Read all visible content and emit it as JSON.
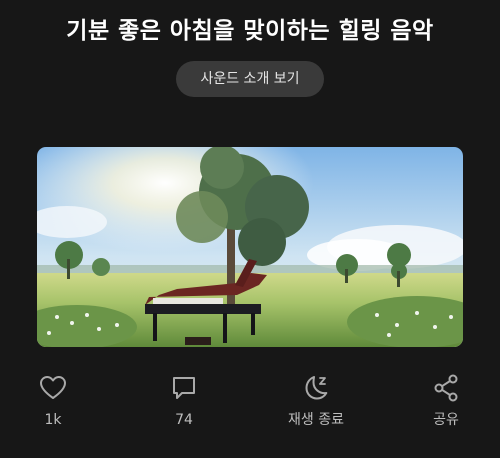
{
  "header": {
    "title": "기분 좋은 아침을 맞이하는 힐링 음악"
  },
  "intro_button": {
    "label": "사운드 소개 보기"
  },
  "hero_image": {
    "icon": "piano-meadow-illustration"
  },
  "actions": {
    "like": {
      "icon": "heart-icon",
      "label": "1k"
    },
    "comment": {
      "icon": "comment-icon",
      "label": "74"
    },
    "sleep_timer": {
      "icon": "moon-zzz-icon",
      "label": "재생 종료"
    },
    "share": {
      "icon": "share-icon",
      "label": "공유"
    }
  },
  "colors": {
    "background": "#171717",
    "button_bg": "#3a3a3a",
    "icon_color": "#a9a9a9",
    "label_color": "#bdbdbd"
  }
}
